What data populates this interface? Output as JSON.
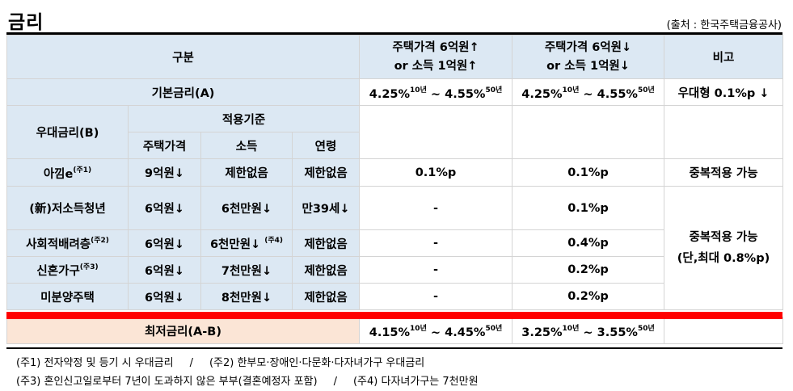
{
  "title": "금리",
  "source": "(출처 : 한국주택금융공사)",
  "header": {
    "category": "구분",
    "col_a_line1": "주택가격 6억원↑",
    "col_a_line2": "or 소득 1억원↑",
    "col_b_line1": "주택가격 6억원↓",
    "col_b_line2": "or 소득 1억원↓",
    "note": "비고"
  },
  "base_rate": {
    "label": "기본금리(A)",
    "a_from": "4.25%",
    "a_from_sup": "10년",
    "a_tilde": "~",
    "a_to": "4.55%",
    "a_to_sup": "50년",
    "b_from": "4.25%",
    "b_from_sup": "10년",
    "b_tilde": "~",
    "b_to": "4.55%",
    "b_to_sup": "50년",
    "note": "우대형 0.1%p ↓"
  },
  "pref": {
    "label": "우대금리(B)",
    "criteria": "적용기준",
    "col_house": "주택가격",
    "col_income": "소득",
    "col_age": "연령"
  },
  "rows": [
    {
      "name": "아낌e",
      "name_sup": "(주1)",
      "house": "9억원↓",
      "income": "제한없음",
      "income_sup": "",
      "age": "제한없음",
      "a": "0.1%p",
      "b": "0.1%p"
    },
    {
      "name": "(新)저소득청년",
      "name_sup": "",
      "house": "6억원↓",
      "income": "6천만원↓",
      "income_sup": "",
      "age": "만39세↓",
      "a": "-",
      "b": "0.1%p"
    },
    {
      "name": "사회적배려층",
      "name_sup": "(주2)",
      "house": "6억원↓",
      "income": "6천만원↓",
      "income_sup": "(주4)",
      "age": "제한없음",
      "a": "-",
      "b": "0.4%p"
    },
    {
      "name": "신혼가구",
      "name_sup": "(주3)",
      "house": "6억원↓",
      "income": "7천만원↓",
      "income_sup": "",
      "age": "제한없음",
      "a": "-",
      "b": "0.2%p"
    },
    {
      "name": "미분양주택",
      "name_sup": "",
      "house": "6억원↓",
      "income": "8천만원↓",
      "income_sup": "",
      "age": "제한없음",
      "a": "-",
      "b": "0.2%p"
    }
  ],
  "notes_col": {
    "dup": "중복적용 가능",
    "dup2_line1": "중복적용 가능",
    "dup2_line2": "(단,최대 0.8%p)"
  },
  "min_rate": {
    "label": "최저금리(A-B)",
    "a_from": "4.15%",
    "a_from_sup": "10년",
    "a_tilde": "~",
    "a_to": "4.45%",
    "a_to_sup": "50년",
    "b_from": "3.25%",
    "b_from_sup": "10년",
    "b_tilde": "~",
    "b_to": "3.55%",
    "b_to_sup": "50년"
  },
  "footnotes": {
    "n1": "(주1) 전자약정 및 등기 시 우대금리",
    "sep": "/",
    "n2": "(주2) 한부모·장애인·다문화·다자녀가구 우대금리",
    "n3": "(주3) 혼인신고일로부터 7년이 도과하지 않은 부부(결혼예정자 포함)",
    "n4": "(주4) 다자녀가구는 7천만원"
  }
}
